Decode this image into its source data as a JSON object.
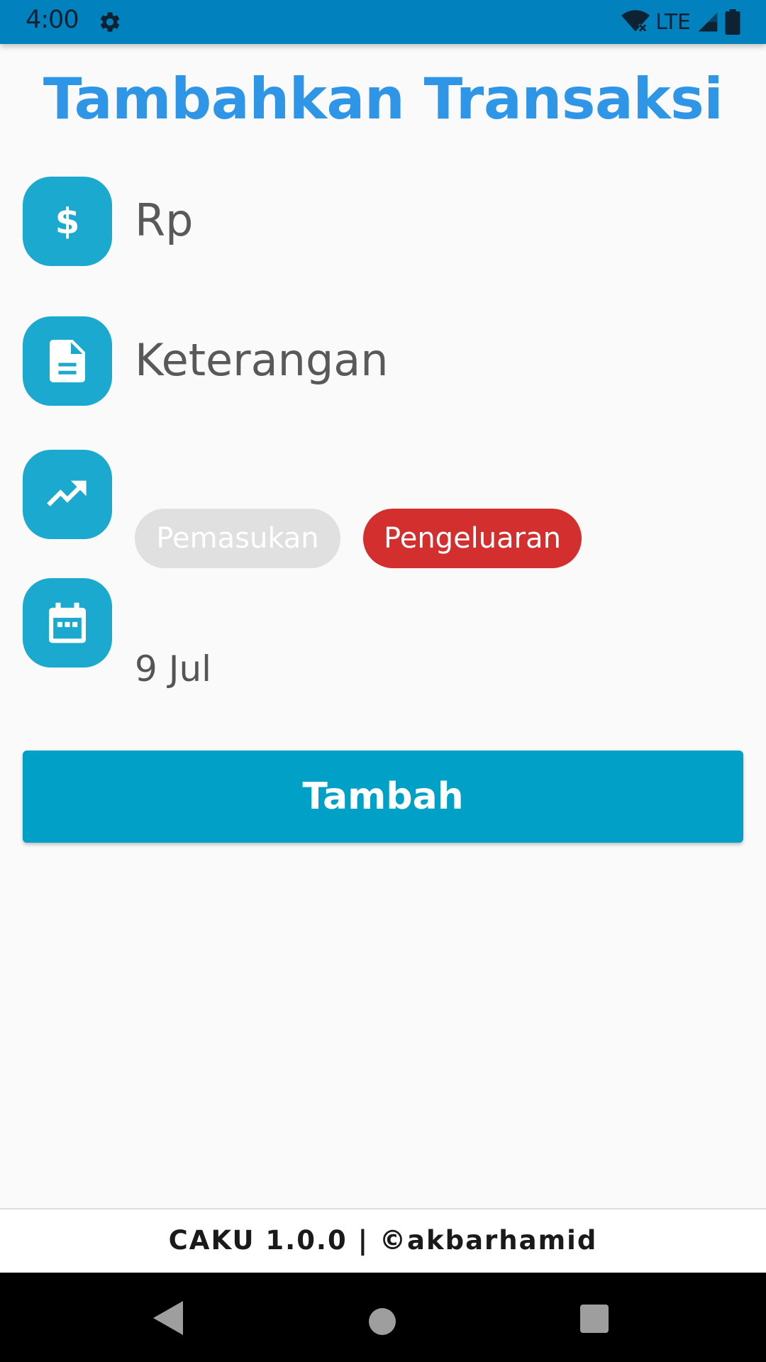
{
  "status_bar": {
    "time": "4:00",
    "network": "LTE",
    "icons": [
      "settings-gear-icon",
      "wifi-x-icon",
      "signal-icon",
      "battery-icon"
    ]
  },
  "page": {
    "title": "Tambahkan Transaksi"
  },
  "form": {
    "amount": {
      "icon": "dollar-icon",
      "placeholder": "Rp",
      "value": ""
    },
    "description": {
      "icon": "document-icon",
      "placeholder": "Keterangan",
      "value": ""
    },
    "type": {
      "icon": "trending-up-icon",
      "options": [
        "Pemasukan",
        "Pengeluaran"
      ],
      "selected": "Pengeluaran"
    },
    "date": {
      "icon": "calendar-icon",
      "value": "9 Jul"
    },
    "submit_label": "Tambah"
  },
  "footer": {
    "text": "CAKU 1.0.0 | ©akbarhamid"
  },
  "colors": {
    "status_bar": "#0281bf",
    "title": "#2f95e6",
    "icon_tile": "#1ba9cf",
    "submit_button": "#00a0c7",
    "chip_selected": "#d32f2f",
    "chip_unselected": "#e0e0e0"
  }
}
